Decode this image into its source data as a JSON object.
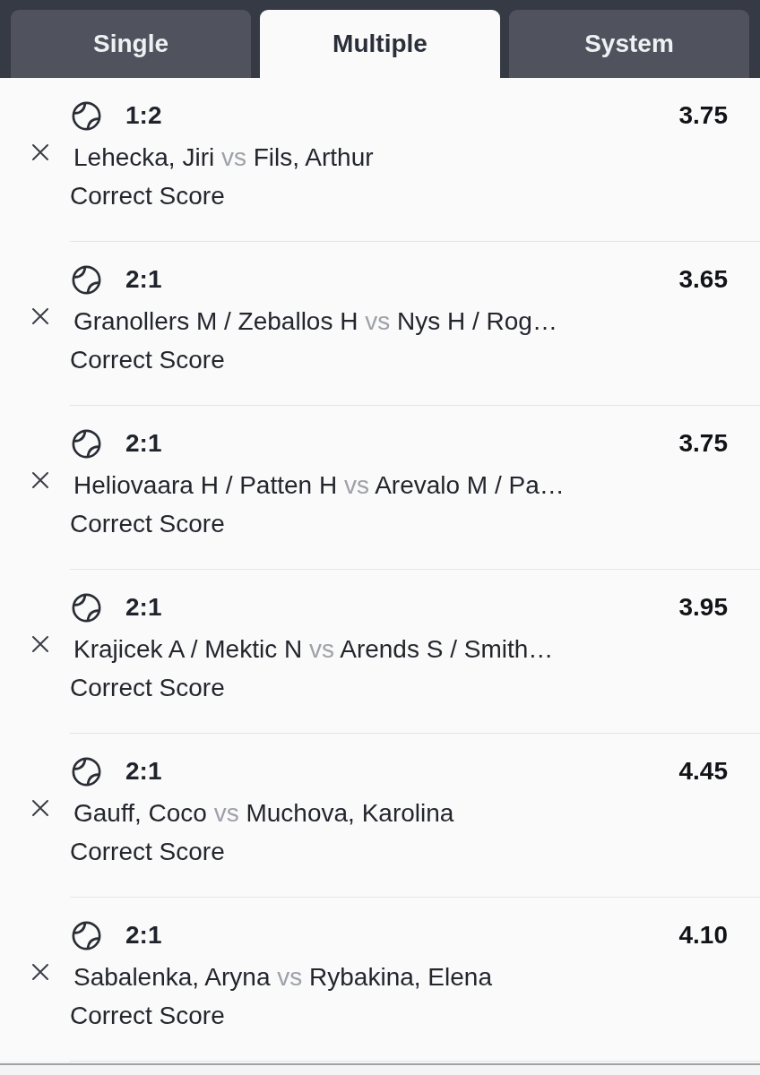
{
  "tabs": [
    {
      "label": "Single",
      "selected": false
    },
    {
      "label": "Multiple",
      "selected": true
    },
    {
      "label": "System",
      "selected": false
    }
  ],
  "selections": [
    {
      "score": "1:2",
      "odds": "3.75",
      "home": "Lehecka, Jiri",
      "separator": "vs",
      "away": "Fils, Arthur",
      "market": "Correct Score"
    },
    {
      "score": "2:1",
      "odds": "3.65",
      "home": "Granollers M / Zeballos H",
      "separator": "vs",
      "away": "Nys H / Rog…",
      "market": "Correct Score"
    },
    {
      "score": "2:1",
      "odds": "3.75",
      "home": "Heliovaara H / Patten H",
      "separator": "vs",
      "away": "Arevalo M / Pa…",
      "market": "Correct Score"
    },
    {
      "score": "2:1",
      "odds": "3.95",
      "home": "Krajicek A / Mektic N",
      "separator": "vs",
      "away": "Arends S / Smith…",
      "market": "Correct Score"
    },
    {
      "score": "2:1",
      "odds": "4.45",
      "home": "Gauff, Coco",
      "separator": "vs",
      "away": "Muchova, Karolina",
      "market": "Correct Score"
    },
    {
      "score": "2:1",
      "odds": "4.10",
      "home": "Sabalenka, Aryna",
      "separator": "vs",
      "away": "Rybakina, Elena",
      "market": "Correct Score"
    }
  ]
}
